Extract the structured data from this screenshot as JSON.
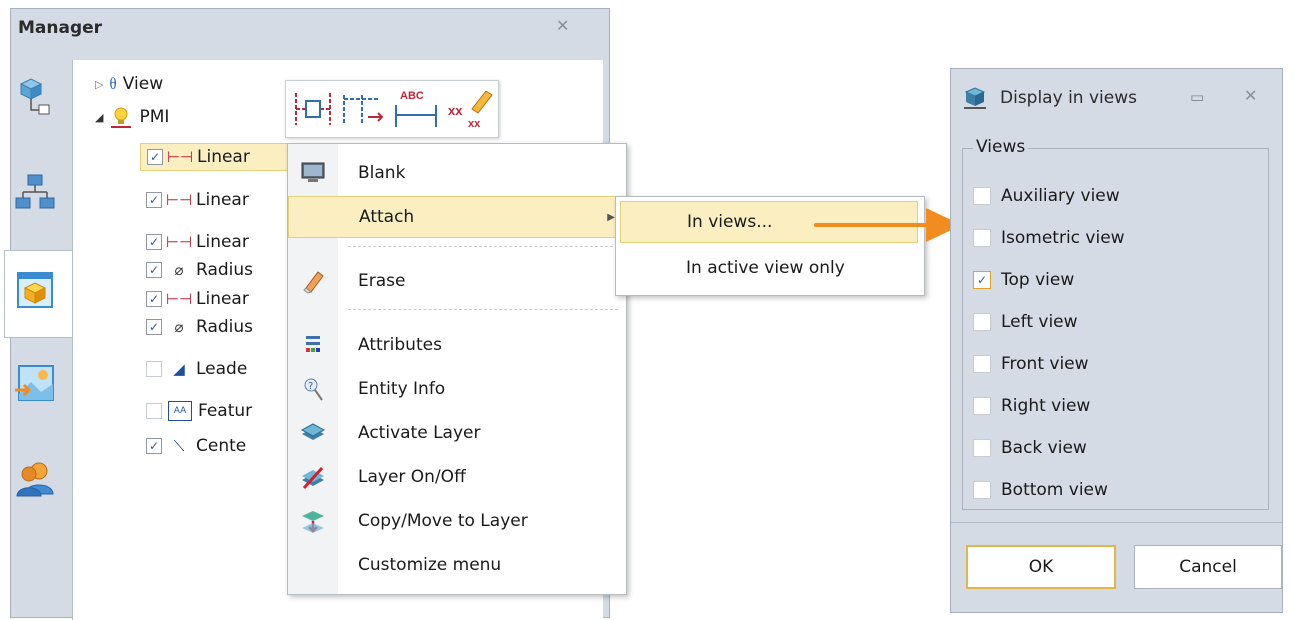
{
  "manager": {
    "title": "Manager",
    "tree": {
      "view_label": "View",
      "pmi_label": "PMI",
      "rows": [
        {
          "label": "Linear",
          "checked": true,
          "icon": "linear-dimension-icon"
        },
        {
          "label": "Linear",
          "checked": true,
          "icon": "linear-dimension-icon"
        },
        {
          "label": "Linear",
          "checked": true,
          "icon": "linear-dimension-icon"
        },
        {
          "label": "Radius",
          "checked": true,
          "icon": "radius-dimension-icon"
        },
        {
          "label": "Linear",
          "checked": true,
          "icon": "linear-dimension-icon"
        },
        {
          "label": "Radius",
          "checked": true,
          "icon": "radius-dimension-icon"
        },
        {
          "label": "Leade",
          "checked": false,
          "icon": "leader-icon"
        },
        {
          "label": "Featur",
          "checked": false,
          "icon": "feature-control-frame-icon"
        },
        {
          "label": "Cente",
          "checked": true,
          "icon": "centerline-icon"
        }
      ]
    },
    "toolbar_abc": "ABC",
    "toolbar_xx": "xx"
  },
  "context_menu": {
    "items": [
      {
        "label": "Blank",
        "icon": "monitor-icon"
      },
      {
        "label": "Attach",
        "icon": ""
      },
      {
        "label": "Erase",
        "icon": "eraser-icon"
      },
      {
        "label": "Attributes",
        "icon": "attributes-icon"
      },
      {
        "label": "Entity Info",
        "icon": "entity-info-icon"
      },
      {
        "label": "Activate Layer",
        "icon": "layer-icon"
      },
      {
        "label": "Layer On/Off",
        "icon": "layer-toggle-icon"
      },
      {
        "label": "Copy/Move to Layer",
        "icon": "layer-move-icon"
      },
      {
        "label": "Customize menu",
        "icon": ""
      }
    ],
    "submenu": [
      "In views...",
      "In active view only"
    ]
  },
  "dialog": {
    "title": "Display in views",
    "group_label": "Views",
    "views": [
      {
        "label": "Auxiliary view",
        "checked": false
      },
      {
        "label": "Isometric view",
        "checked": false
      },
      {
        "label": "Top view",
        "checked": true
      },
      {
        "label": "Left view",
        "checked": false
      },
      {
        "label": "Front view",
        "checked": false
      },
      {
        "label": "Right view",
        "checked": false
      },
      {
        "label": "Back view",
        "checked": false
      },
      {
        "label": "Bottom view",
        "checked": false
      }
    ],
    "ok_label": "OK",
    "cancel_label": "Cancel"
  },
  "colors": {
    "accent_orange": "#f28c1e",
    "highlight": "#fbefc1",
    "panel": "#d4dbe5"
  }
}
